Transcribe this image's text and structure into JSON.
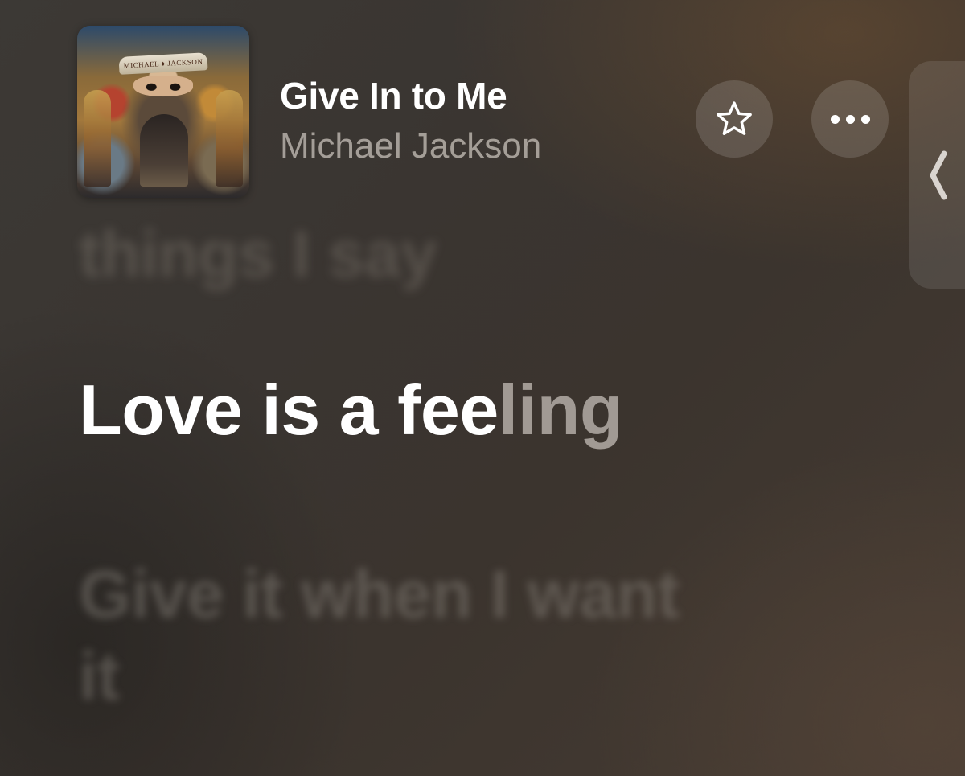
{
  "now_playing": {
    "title": "Give In to Me",
    "artist": "Michael Jackson",
    "album_art_text": "MICHAEL ♦ JACKSON",
    "album_art_icon": "album-cover"
  },
  "actions": {
    "favorite_icon": "star-outline-icon",
    "more_icon": "ellipsis-icon"
  },
  "side_panel": {
    "icon": "chevron-left-icon"
  },
  "lyrics": {
    "previous_line": "things I say",
    "current_line_sung": "Love is a fee",
    "current_line_unsung": "ling",
    "next_line": "Give it when I want it"
  },
  "colors": {
    "current_lyric": "#ffffff",
    "dimmed_lyric": "#8f8983"
  }
}
